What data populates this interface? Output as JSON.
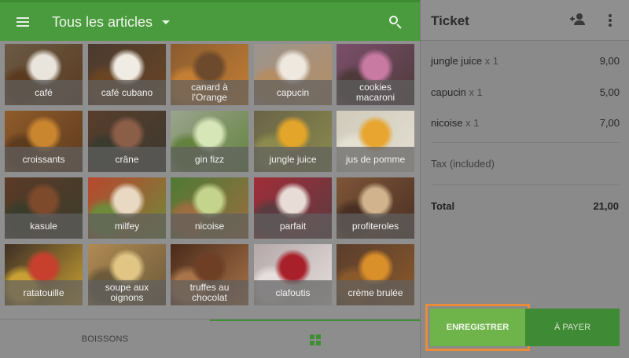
{
  "header": {
    "category_title": "Tous les articles",
    "icons": {
      "menu": "menu-icon",
      "dropdown": "caret-down-icon",
      "search": "search-icon"
    }
  },
  "products": [
    {
      "label": "café",
      "c1": "#6b5a46",
      "c2": "#e9e4dc",
      "c3": "#5a3b1f"
    },
    {
      "label": "café cubano",
      "c1": "#4a3b30",
      "c2": "#f1ece3",
      "c3": "#6a4523"
    },
    {
      "label": "canard à l'Orange",
      "c1": "#8a5b2f",
      "c2": "#6d4a2b",
      "c3": "#c47f34"
    },
    {
      "label": "capucin",
      "c1": "#9b9590",
      "c2": "#efe8de",
      "c3": "#b58d62"
    },
    {
      "label": "cookies macaroni",
      "c1": "#7b4f6b",
      "c2": "#c87aa2",
      "c3": "#4e3a3a"
    },
    {
      "label": "croissants",
      "c1": "#8f5b2a",
      "c2": "#c9862f",
      "c3": "#5d3b1e"
    },
    {
      "label": "crâne",
      "c1": "#5a3d2c",
      "c2": "#8b5e48",
      "c3": "#3a3a2f"
    },
    {
      "label": "gin fizz",
      "c1": "#9aa58d",
      "c2": "#d7e6b6",
      "c3": "#64823f"
    },
    {
      "label": "jungle juice",
      "c1": "#6a6348",
      "c2": "#e3a52a",
      "c3": "#8b8b4d"
    },
    {
      "label": "jus de pomme",
      "c1": "#cfcaba",
      "c2": "#e8a52f",
      "c3": "#e4e0d2"
    },
    {
      "label": "kasule",
      "c1": "#5b3a28",
      "c2": "#7d4a2c",
      "c3": "#3c3c2a"
    },
    {
      "label": "milfey",
      "c1": "#b8472f",
      "c2": "#e9d8c2",
      "c3": "#6f8a3a"
    },
    {
      "label": "nicoise",
      "c1": "#4f7a35",
      "c2": "#c5d48c",
      "c3": "#9b6d3f"
    },
    {
      "label": "parfait",
      "c1": "#a12d38",
      "c2": "#e7dcd6",
      "c3": "#5a3b40"
    },
    {
      "label": "profiteroles",
      "c1": "#7e5537",
      "c2": "#d1b48e",
      "c3": "#4a3024"
    },
    {
      "label": "ratatouille",
      "c1": "#3e2f26",
      "c2": "#c6402d",
      "c3": "#c8a033"
    },
    {
      "label": "soupe aux oignons",
      "c1": "#b08a52",
      "c2": "#e0c584",
      "c3": "#6b5a3b"
    },
    {
      "label": "truffes au chocolat",
      "c1": "#4a2a1a",
      "c2": "#6e3f25",
      "c3": "#a8744a"
    },
    {
      "label": "clafoutis",
      "c1": "#b4a8a8",
      "c2": "#a8202a",
      "c3": "#e6dfdd"
    },
    {
      "label": "crème brulée",
      "c1": "#5a3d2c",
      "c2": "#d98f2a",
      "c3": "#8a5a2b"
    }
  ],
  "bottom_tabs": {
    "drinks_label": "BOISSONS",
    "grid_icon": "grid-icon"
  },
  "ticket": {
    "title": "Ticket",
    "icons": {
      "add_customer": "add-customer-icon",
      "more": "more-vertical-icon"
    },
    "lines": [
      {
        "name": "jungle juice",
        "qty": "x 1",
        "price": "9,00"
      },
      {
        "name": "capucin",
        "qty": "x 1",
        "price": "5,00"
      },
      {
        "name": "nicoise",
        "qty": "x 1",
        "price": "7,00"
      }
    ],
    "tax_label": "Tax (included)",
    "total_label": "Total",
    "total_value": "21,00"
  },
  "actions": {
    "save_label": "ENREGISTRER",
    "pay_label": "À PAYER"
  },
  "colors": {
    "brand_green": "#4a9b3d",
    "save_green": "#6fb44a",
    "pay_green": "#3f8a34",
    "highlight_orange": "#ea8b3a"
  }
}
